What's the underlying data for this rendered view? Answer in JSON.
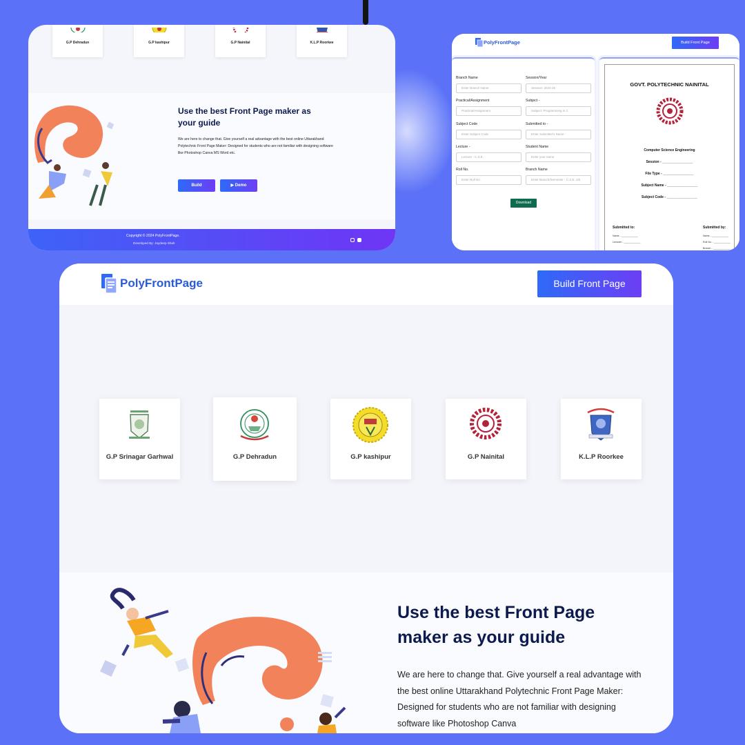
{
  "brand": {
    "name": "PolyFrontPage",
    "accent_gradient": [
      "#2e6af7",
      "#6d3ef5"
    ],
    "text_color": "#2a5bd7",
    "page_background": "#5b72f8"
  },
  "nav": {
    "build_label": "Build Front Page"
  },
  "colleges": [
    {
      "name": "G.P Srinagar Garhwal"
    },
    {
      "name": "G.P Dehradun"
    },
    {
      "name": "G.P kashipur"
    },
    {
      "name": "G.P Nainital"
    },
    {
      "name": "K.L.P Roorkee"
    }
  ],
  "hero": {
    "title_short": "Use the best Front Page maker as your guide",
    "title": "Use the best Front Page maker as your guide",
    "text_full": "We are here to change that. Give yourself a real advantage with the best online Uttarakhand Polytechnic Front Page Maker: Designed for students who are not familiar with designing software like Photoshop Canva MS Word etc.",
    "text_clipped": "We are here to change that. Give yourself a real advantage with the best online Uttarakhand Polytechnic Front Page Maker: Designed for students who are not familiar with designing software like Photoshop Canva",
    "build_label": "Build",
    "demo_label": "Demo"
  },
  "footer": {
    "copyright": "Copyright © 2024 PolyFrontPage.",
    "developer": "Developed By: Joydeep Shah"
  },
  "form": {
    "fields": [
      {
        "label": "Branch Name",
        "placeholder": "Enter Branch Name"
      },
      {
        "label": "Session/Year",
        "placeholder": "Session: 2024-25"
      },
      {
        "label": "Practical/Assignment",
        "placeholder": "Practical/Assignment"
      },
      {
        "label": "Subject -",
        "placeholder": "Subject: Programming in C"
      },
      {
        "label": "Subject Code",
        "placeholder": "Enter Subject Code"
      },
      {
        "label": "Submitted to -",
        "placeholder": "Enter Submitter's Name -"
      },
      {
        "label": "Lecture -",
        "placeholder": "Lecture - C.S.E"
      },
      {
        "label": "Student Name",
        "placeholder": "Enter your name"
      },
      {
        "label": "Roll No.",
        "placeholder": "Enter Roll No."
      },
      {
        "label": "Branch Name",
        "placeholder": "Enter Branch/Semester - C.S.E. 4th"
      }
    ],
    "download_label": "Download"
  },
  "preview": {
    "title": "GOVT. POLYTECHNIC NAINITAL",
    "department": "Computer Science Engineering",
    "session": "Session - ________________",
    "file_type": "File Type - ________________",
    "subject_name": "Subject Name - ________________",
    "subject_code": "Subject Code - ________________",
    "submitted_to": "Submitted to:",
    "submitted_by": "Submitted by:",
    "name_line": "Name - ____________",
    "lecturer_line": "Lecturer - ____________",
    "rollno_line": "Roll No. - ____________",
    "branch_line": "Branch - ____________"
  }
}
